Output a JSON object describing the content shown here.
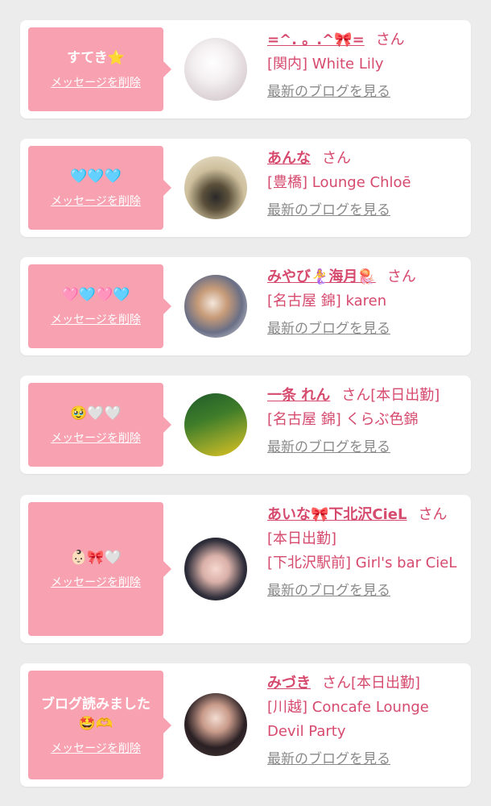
{
  "delete_label": "メッセージを削除",
  "blog_label": "最新のブログを見る",
  "san_label": "さん",
  "cards": [
    {
      "message": "すてき⭐",
      "name": "=^. 。.^🎀=",
      "status": "",
      "shop": "[関内] White Lily"
    },
    {
      "message": "🩵🩵🩵",
      "name": "あんな",
      "status": "",
      "shop": "[豊橋] Lounge Chloē"
    },
    {
      "message": "🩷🩵🩷🩵",
      "name": "みやび🧜‍♀️海月🪼",
      "status": "",
      "shop": "[名古屋 錦] karen"
    },
    {
      "message": "🥹🤍🤍",
      "name": "一条 れん",
      "status": "[本日出勤]",
      "shop": "[名古屋 錦] くらぶ色錦"
    },
    {
      "message": "👶🏻🎀🤍",
      "name": "あいな🎀下北沢CieL",
      "status": "[本日出勤]",
      "shop": "[下北沢駅前] Girl's bar CieL"
    },
    {
      "message": "ブログ読みました🤩🫶",
      "name": "みづき",
      "status": "[本日出勤]",
      "shop": "[川越] Concafe Lounge Devil Party"
    }
  ]
}
